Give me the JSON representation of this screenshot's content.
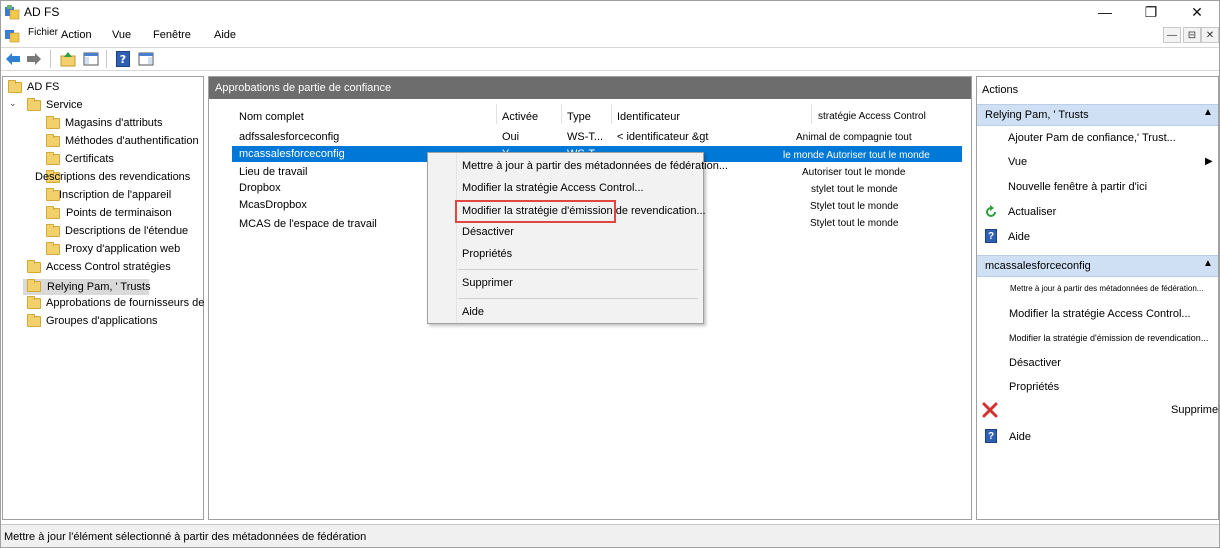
{
  "window": {
    "title": "AD FS",
    "minimize": "—",
    "maximize": "❐",
    "close": "✕"
  },
  "menu": [
    "Fichier",
    "Action",
    "Vue",
    "Fenêtre",
    "Aide"
  ],
  "mdi_controls": [
    "—",
    "⊟",
    "✕"
  ],
  "tree": {
    "root": "AD FS",
    "items": [
      "Service",
      "Magasins d'attributs",
      "Méthodes d'authentification",
      "Certificats",
      "Descriptions des revendications",
      "Inscription de l'appareil",
      "Points de terminaison",
      "Descriptions de l'étendue",
      "Proxy d'application web",
      "Access Control stratégies",
      "Relying Pam, ' Trusts",
      "Approbations de fournisseurs de revendications",
      "Groupes d'applications"
    ]
  },
  "center": {
    "title": "Approbations de partie de confiance",
    "columns": [
      "Nom complet",
      "Activée",
      "Type",
      "Identificateur",
      "stratégie Access Control"
    ],
    "rows": [
      {
        "name": "adfssalesforceconfig",
        "enabled": "Oui",
        "type": "WS-T...",
        "identifier": "< identificateur &gt",
        "policy": "Animal de compagnie tout"
      },
      {
        "name": "mcassalesforceconfig",
        "enabled": "Y",
        "type": "WS-T",
        "identifier": "",
        "policy": "le monde Autoriser tout le monde"
      },
      {
        "name": "Lieu de travail",
        "enabled": "",
        "type": "",
        "identifier": "",
        "policy": "Autoriser tout le monde"
      },
      {
        "name": "Dropbox",
        "enabled": "",
        "type": "",
        "identifier": "",
        "policy": "stylet tout le monde"
      },
      {
        "name": "McasDropbox",
        "enabled": "",
        "type": "",
        "identifier": "",
        "policy": "Stylet tout le monde"
      },
      {
        "name": "MCAS de l'espace de travail",
        "enabled": "",
        "type": "",
        "identifier": "",
        "policy": "Stylet tout le monde"
      }
    ]
  },
  "context_menu": {
    "items": [
      "Mettre à jour à partir des métadonnées de fédération...",
      "Modifier la stratégie Access Control...",
      "Modifier la stratégie d'émission de revendication...",
      "Désactiver",
      "Propriétés",
      "Supprimer",
      "Aide"
    ]
  },
  "actions": {
    "title": "Actions",
    "section1": {
      "header": "Relying Pam, ' Trusts",
      "items": [
        "Ajouter Pam de confiance,' Trust...",
        "Vue",
        "Nouvelle fenêtre à partir d'ici",
        "Actualiser",
        "Aide"
      ]
    },
    "section2": {
      "header": "mcassalesforceconfig",
      "items": [
        "Mettre à jour à partir des métadonnées de fédération...",
        "Modifier la stratégie Access Control...",
        "Modifier la stratégie d'émission de revendication...",
        "Désactiver",
        "Propriétés",
        "Supprimer",
        "Aide"
      ]
    }
  },
  "status": "Mettre à jour l'élément sélectionné à partir des métadonnées de fédération",
  "colors": {
    "accent": "#0078d7",
    "header_band": "#6d6d6d",
    "action_band": "#cfe0f5",
    "highlight": "#e0473e"
  }
}
